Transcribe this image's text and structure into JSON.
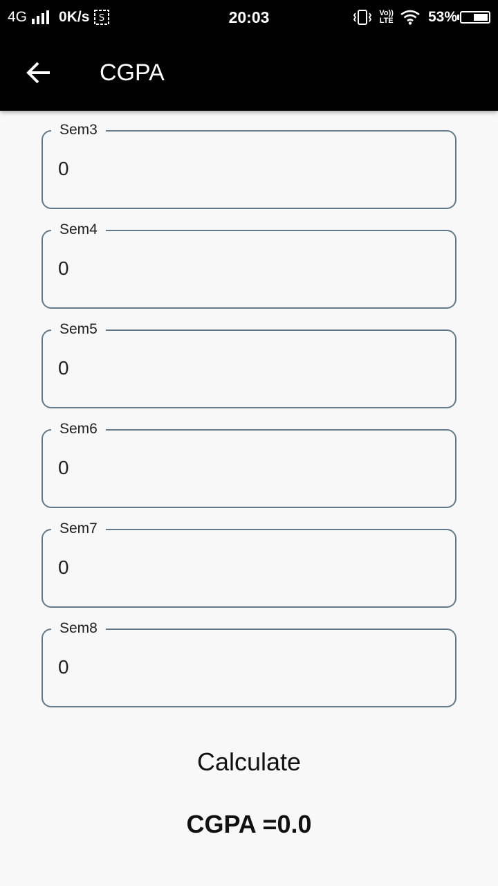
{
  "status_bar": {
    "network": "4G",
    "speed": "0K/s",
    "time": "20:03",
    "volte_top": "Vo))",
    "volte_bottom": "LTE",
    "battery": "53%"
  },
  "app_bar": {
    "title": "CGPA",
    "back_icon": "arrow-back-icon"
  },
  "fields": [
    {
      "label": "Sem3",
      "value": "0"
    },
    {
      "label": "Sem4",
      "value": "0"
    },
    {
      "label": "Sem5",
      "value": "0"
    },
    {
      "label": "Sem6",
      "value": "0"
    },
    {
      "label": "Sem7",
      "value": "0"
    },
    {
      "label": "Sem8",
      "value": "0"
    }
  ],
  "calculate_label": "Calculate",
  "result_text": "CGPA =0.0",
  "colors": {
    "app_bar": "#000000",
    "background": "#f8f8f8",
    "field_border": "#5f7a8c"
  }
}
